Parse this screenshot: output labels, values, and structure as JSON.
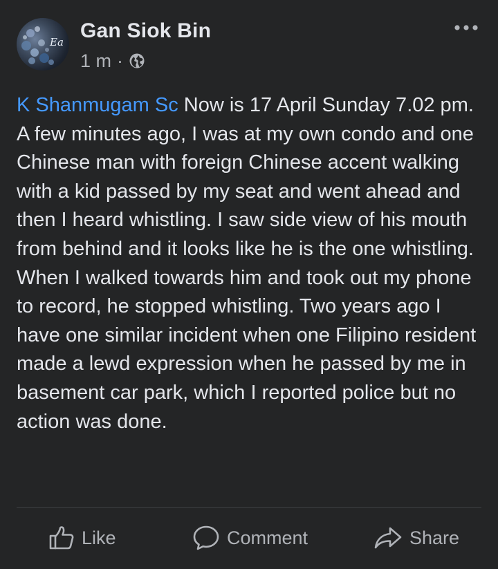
{
  "post": {
    "author": "Gan Siok Bin",
    "time": "1 m",
    "separator": "·",
    "privacy_icon": "globe-icon",
    "avatar_text": "Ea",
    "mention": "K Shanmugam Sc",
    "body": " Now is 17 April Sunday 7.02 pm. A few minutes ago, I was at my own condo and one Chinese man with foreign Chinese accent walking with a kid passed by my seat and went ahead and then I heard whistling. I saw side view of his mouth from behind and it looks like he is the one whistling. When I walked towards him and took out my phone to record, he stopped whistling. Two years ago I have one similar incident when one Filipino resident made a lewd expression when he passed by me in basement car park, which I reported police but no action was done."
  },
  "actions": {
    "like_label": "Like",
    "comment_label": "Comment",
    "share_label": "Share"
  },
  "colors": {
    "background": "#242526",
    "text": "#e4e6eb",
    "secondary_text": "#b0b3b8",
    "mention": "#4599ff"
  }
}
